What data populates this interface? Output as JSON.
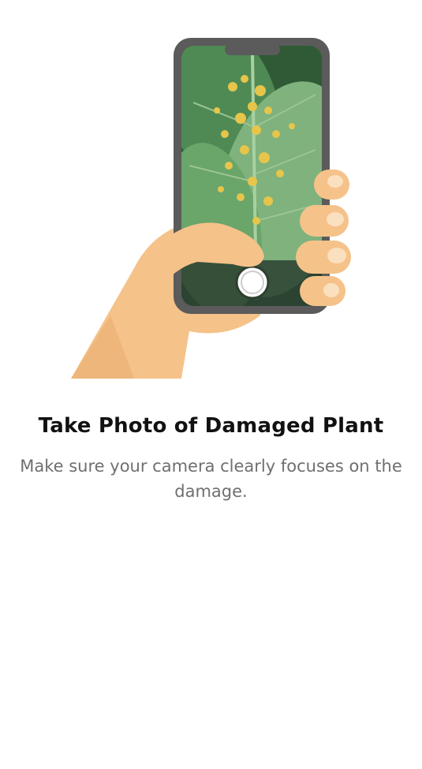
{
  "onboarding": {
    "illustration_icon": "hand-holding-phone-photographing-leaf-icon",
    "title": "Take Photo of Damaged Plant",
    "description": "Make sure your camera clearly focuses on the damage."
  },
  "colors": {
    "background": "#ffffff",
    "title": "#111111",
    "description": "#6f6f6f",
    "skin": "#f5c28a",
    "phone_frame": "#5b5b5b",
    "leaf_green": "#6aa56a",
    "spot_yellow": "#e6c54a"
  }
}
